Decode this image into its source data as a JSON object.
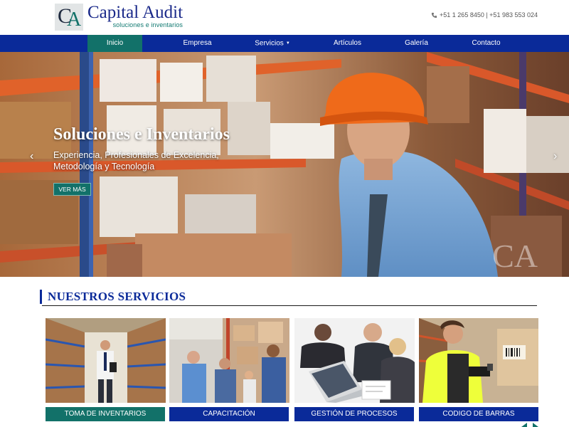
{
  "header": {
    "brand": "Capital Audit",
    "tagline": "soluciones e inventarios",
    "logo_letters": "CA",
    "phones": "+51 1 265 8450  | +51 983 553 024"
  },
  "nav": {
    "items": [
      {
        "label": "Inicio",
        "active": true
      },
      {
        "label": "Empresa"
      },
      {
        "label": "Servicios",
        "has_dropdown": true
      },
      {
        "label": "Artículos"
      },
      {
        "label": "Galería"
      },
      {
        "label": "Contacto"
      }
    ]
  },
  "hero": {
    "title": "Soluciones e Inventarios",
    "subtitle": "Experiencia, Profesionales de Excelencia, Metodología y Tecnología",
    "button": "VER MÁS",
    "prev": "‹",
    "next": "›",
    "watermark": "CA"
  },
  "services": {
    "heading": "NUESTROS SERVICIOS",
    "cards": [
      {
        "label": "TOMA DE INVENTARIOS",
        "icon": "warehouse-photo"
      },
      {
        "label": "CAPACITACIÓN",
        "icon": "training-photo"
      },
      {
        "label": "GESTIÓN DE PROCESOS",
        "icon": "meeting-photo"
      },
      {
        "label": "CODIGO DE BARRAS",
        "icon": "barcode-scanner-photo"
      }
    ]
  },
  "colors": {
    "nav_blue": "#0a2a99",
    "accent_teal": "#127169"
  }
}
